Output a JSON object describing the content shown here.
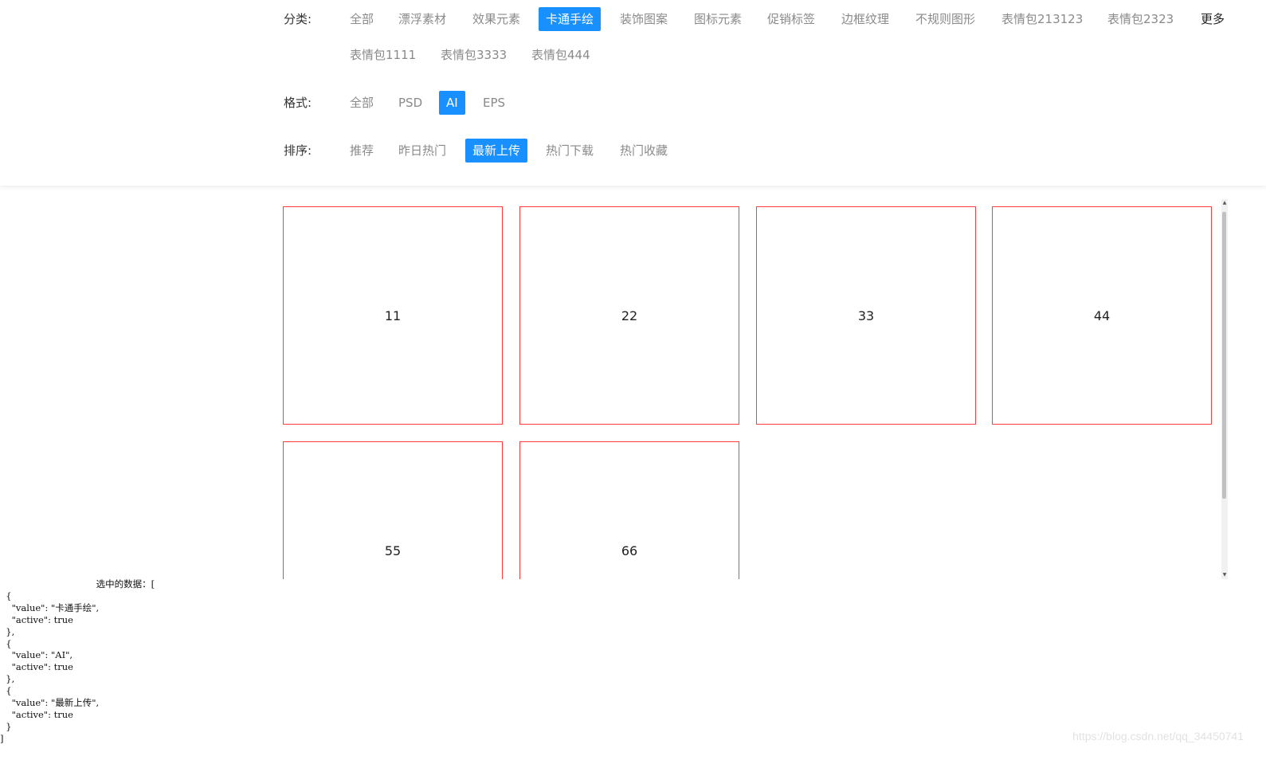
{
  "filters": {
    "category": {
      "label": "分类:",
      "options": [
        {
          "label": "全部",
          "active": false
        },
        {
          "label": "漂浮素材",
          "active": false
        },
        {
          "label": "效果元素",
          "active": false
        },
        {
          "label": "卡通手绘",
          "active": true
        },
        {
          "label": "装饰图案",
          "active": false
        },
        {
          "label": "图标元素",
          "active": false
        },
        {
          "label": "促销标签",
          "active": false
        },
        {
          "label": "边框纹理",
          "active": false
        },
        {
          "label": "不规则图形",
          "active": false
        },
        {
          "label": "表情包213123",
          "active": false
        },
        {
          "label": "表情包2323",
          "active": false
        },
        {
          "label": "表情包1111",
          "active": false
        },
        {
          "label": "表情包3333",
          "active": false
        },
        {
          "label": "表情包444",
          "active": false
        }
      ],
      "more_label": "更多"
    },
    "format": {
      "label": "格式:",
      "options": [
        {
          "label": "全部",
          "active": false
        },
        {
          "label": "PSD",
          "active": false
        },
        {
          "label": "AI",
          "active": true
        },
        {
          "label": "EPS",
          "active": false
        }
      ]
    },
    "sort": {
      "label": "排序:",
      "options": [
        {
          "label": "推荐",
          "active": false
        },
        {
          "label": "昨日热门",
          "active": false
        },
        {
          "label": "最新上传",
          "active": true
        },
        {
          "label": "热门下载",
          "active": false
        },
        {
          "label": "热门收藏",
          "active": false
        }
      ]
    }
  },
  "cards": [
    "11",
    "22",
    "33",
    "44",
    "55",
    "66"
  ],
  "selected_output": "                                 选中的数据：[\n  {\n    \"value\": \"卡通手绘\",\n    \"active\": true\n  },\n  {\n    \"value\": \"AI\",\n    \"active\": true\n  },\n  {\n    \"value\": \"最新上传\",\n    \"active\": true\n  }\n]",
  "watermark": "https://blog.csdn.net/qq_34450741",
  "colors": {
    "accent": "#1890ff",
    "card_border": "#ff3b3b",
    "option_text": "#8a8a8a"
  }
}
